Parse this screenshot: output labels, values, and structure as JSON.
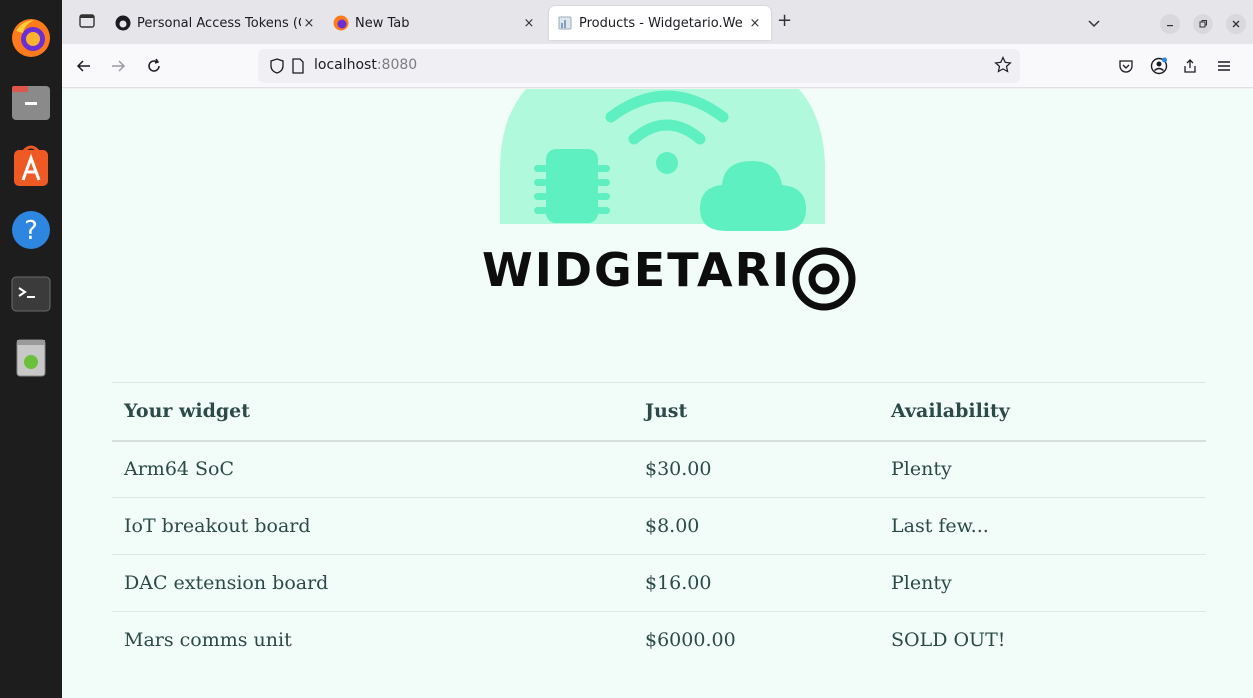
{
  "browser": {
    "tabs": [
      {
        "title": "Personal Access Tokens (C",
        "icon": "github-icon",
        "active": false
      },
      {
        "title": "New Tab",
        "icon": "firefox-icon",
        "active": false
      },
      {
        "title": "Products - Widgetario.We",
        "icon": "page-icon",
        "active": true
      }
    ],
    "close_glyph": "×",
    "new_tab_glyph": "+",
    "url": {
      "host": "localhost",
      "port": ":8080"
    }
  },
  "dock": {
    "items": [
      "firefox-icon",
      "files-icon",
      "app-center-icon",
      "help-icon",
      "terminal-icon",
      "trash-icon"
    ]
  },
  "page": {
    "logo_text": "WIDGETARI",
    "table": {
      "headers": [
        "Your widget",
        "Just",
        "Availability"
      ],
      "rows": [
        [
          "Arm64 SoC",
          "$30.00",
          "Plenty"
        ],
        [
          "IoT breakout board",
          "$8.00",
          "Last few..."
        ],
        [
          "DAC extension board",
          "$16.00",
          "Plenty"
        ],
        [
          "Mars comms unit",
          "$6000.00",
          "SOLD OUT!"
        ]
      ]
    }
  },
  "colors": {
    "accent": "#5ef0c0",
    "logo_bg": "#b0f9dc",
    "page_bg": "#f2fcf8",
    "table_text": "#2b4a48"
  }
}
